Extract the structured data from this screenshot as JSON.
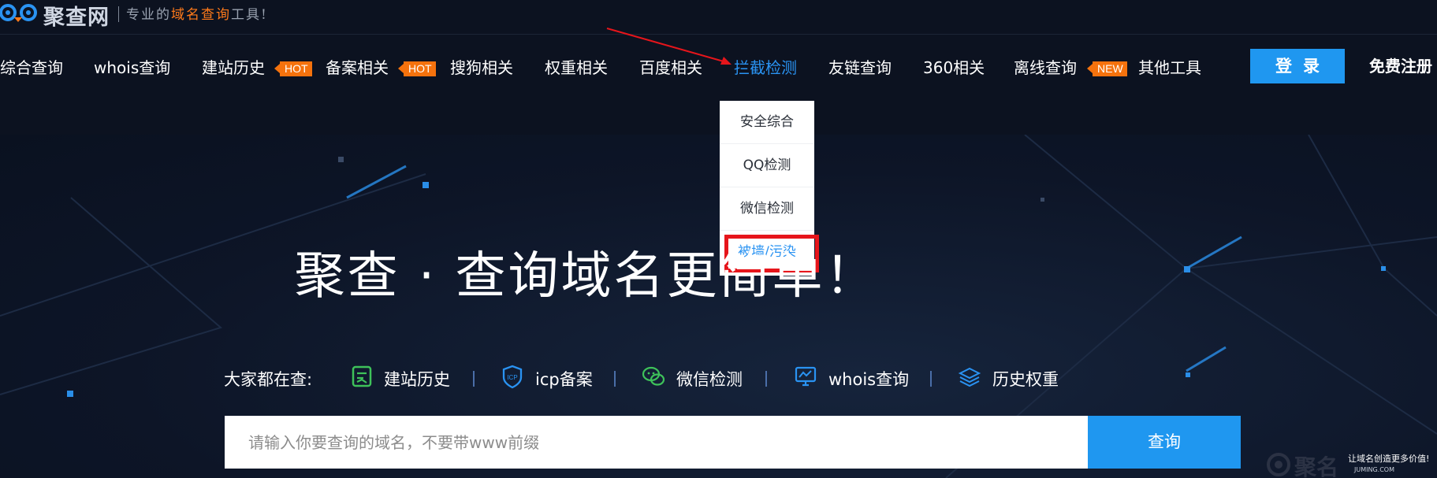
{
  "logo": {
    "name": "聚查网",
    "slogan_prefix": "专业的",
    "slogan_highlight": "域名查询",
    "slogan_suffix": "工具!"
  },
  "nav": {
    "items": [
      {
        "label": "综合查询"
      },
      {
        "label": "whois查询"
      },
      {
        "label": "建站历史",
        "badge": "HOT"
      },
      {
        "label": "备案相关",
        "badge": "HOT"
      },
      {
        "label": "搜狗相关"
      },
      {
        "label": "权重相关"
      },
      {
        "label": "百度相关"
      },
      {
        "label": "拦截检测",
        "active": true
      },
      {
        "label": "友链查询"
      },
      {
        "label": "360相关"
      },
      {
        "label": "离线查询",
        "badge": "NEW"
      },
      {
        "label": "其他工具"
      }
    ],
    "login": "登录",
    "register": "免费注册"
  },
  "dropdown": {
    "items": [
      "安全综合",
      "QQ检测",
      "微信检测",
      "被墙/污染"
    ],
    "highlighted_index": 3
  },
  "hero": {
    "title": "聚查 · 查询域名更简单！",
    "quick_label": "大家都在查:",
    "quick_links": [
      {
        "label": "建站历史",
        "icon": "history-doc-icon"
      },
      {
        "label": "icp备案",
        "icon": "icp-shield-icon"
      },
      {
        "label": "微信检测",
        "icon": "wechat-icon"
      },
      {
        "label": "whois查询",
        "icon": "monitor-chart-icon"
      },
      {
        "label": "历史权重",
        "icon": "stack-layers-icon"
      }
    ]
  },
  "search": {
    "placeholder": "请输入你要查询的域名，不要带www前缀",
    "button": "查询"
  },
  "watermark": {
    "text": "聚名",
    "slogan": "让域名创造更多价值!",
    "url": "JUMING.COM"
  },
  "colors": {
    "accent": "#1f97f0",
    "badge": "#f5720d",
    "highlight_box": "#e6151b",
    "background": "#0e1524"
  }
}
